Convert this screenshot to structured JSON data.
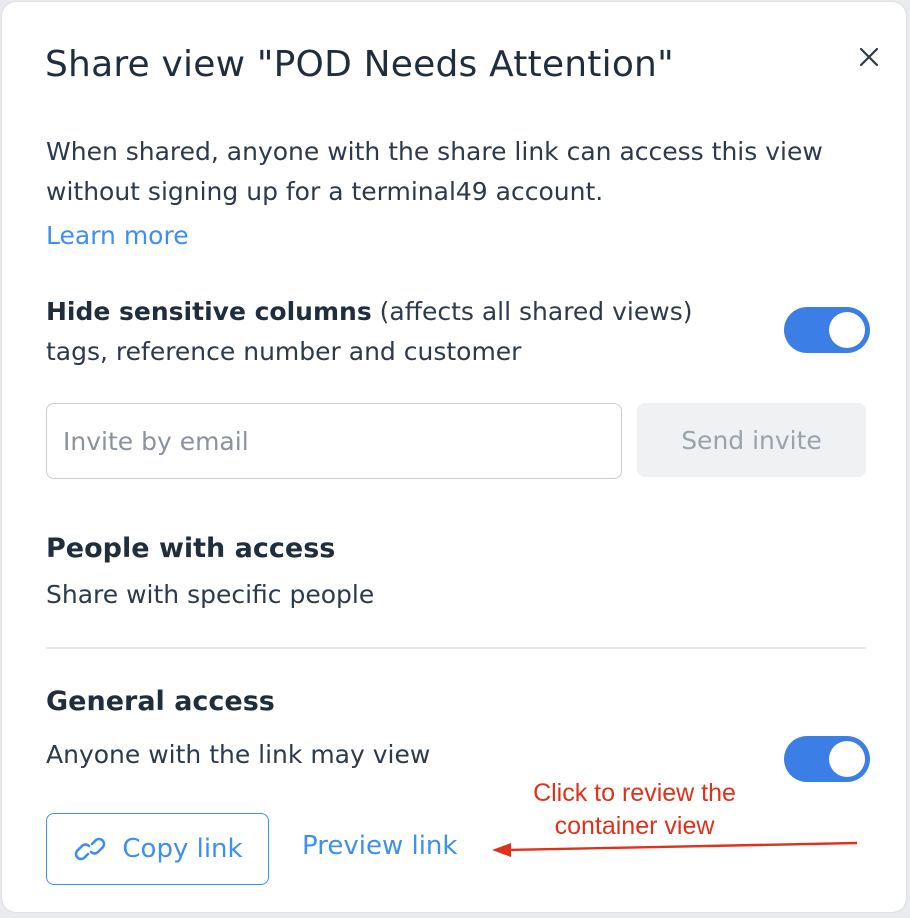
{
  "dialog": {
    "title": "Share view \"POD Needs Attention\"",
    "close_icon": "close-icon",
    "description": "When shared, anyone with the share link can access this view without signing up for a terminal49 account.",
    "learn_more": "Learn more"
  },
  "sensitive": {
    "label_bold": "Hide sensitive columns",
    "label_note": " (affects all shared views)",
    "detail": "tags, reference number and customer",
    "toggle_on": true
  },
  "invite": {
    "placeholder": "Invite by email",
    "value": "",
    "send_label": "Send invite"
  },
  "people": {
    "heading": "People with access",
    "subtitle": "Share with specific people"
  },
  "general": {
    "heading": "General access",
    "subtitle": "Anyone with the link may view",
    "toggle_on": true,
    "copy_label": "Copy link",
    "copy_icon": "link-icon",
    "preview_label": "Preview link"
  },
  "annotation": {
    "text": "Click to review the container view",
    "color": "#e0311b"
  },
  "colors": {
    "accent": "#3d8ff0",
    "toggle": "#3b7fe6",
    "text": "#1f2d3d"
  }
}
